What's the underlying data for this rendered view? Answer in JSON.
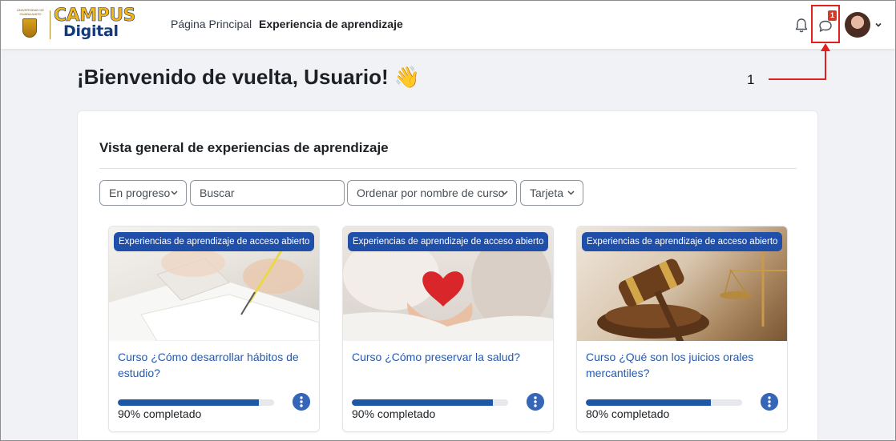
{
  "brand": {
    "seal_text": "UNIVERSIDAD DE GUANAJUATO",
    "name_top": "CAMPUS",
    "name_bottom": "Digital"
  },
  "nav": {
    "links": [
      {
        "label": "Página Principal",
        "active": false
      },
      {
        "label": "Experiencia de aprendizaje",
        "active": true
      }
    ],
    "notifications_icon": "bell-icon",
    "messages_icon": "chat-bubble-icon",
    "messages_badge": "1",
    "user_menu_icon": "chevron-down-icon"
  },
  "annotation": {
    "number": "1",
    "color": "#e0211c"
  },
  "welcome": {
    "text": "¡Bienvenido de vuelta, Usuario!",
    "emoji": "👋"
  },
  "overview": {
    "title": "Vista general de experiencias de aprendizaje",
    "filter_value": "En progreso",
    "search_placeholder": "Buscar",
    "sort_value": "Ordenar por nombre de curso",
    "view_value": "Tarjeta"
  },
  "courses": [
    {
      "badge": "Experiencias de aprendizaje de acceso abierto",
      "title": "Curso ¿Cómo desarrollar hábitos de estudio?",
      "progress": 90,
      "progress_label": "90% completado",
      "image": "study-notebook-image"
    },
    {
      "badge": "Experiencias de aprendizaje de acceso abierto",
      "title": "Curso ¿Cómo preservar la salud?",
      "progress": 90,
      "progress_label": "90% completado",
      "image": "heart-hands-image"
    },
    {
      "badge": "Experiencias de aprendizaje de acceso abierto",
      "title": "Curso ¿Qué son los juicios orales mercantiles?",
      "progress": 80,
      "progress_label": "80% completado",
      "image": "gavel-scales-image"
    }
  ],
  "colors": {
    "accent": "#1f4fa8",
    "link": "#2759ab",
    "progress": "#1c58a6",
    "page_bg": "#f0f2f5"
  }
}
